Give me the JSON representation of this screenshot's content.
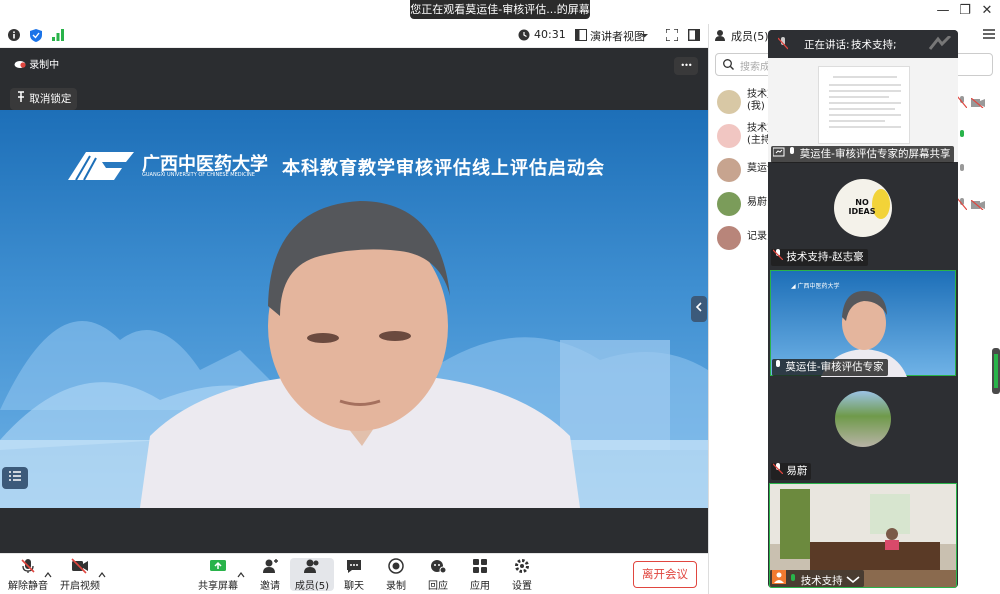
{
  "share_banner": "您正在观看莫运佳-审核评估...的屏幕",
  "window_controls": [
    "—",
    "❐",
    "✕"
  ],
  "toolbar": {
    "timer": "40:31",
    "view_mode": "演讲者视图"
  },
  "video": {
    "recording": "录制中",
    "unpin": "取消锁定",
    "more": "•••",
    "slide_title": "本科教育教学审核评估线上评估启动会",
    "logo_text": "广西中医药大学",
    "logo_sub": "GUANGXI UNIVERSITY OF CHINESE MEDICINE"
  },
  "bottom_bar": {
    "unmute": "解除静音",
    "start_video": "开启视频",
    "share": "共享屏幕",
    "invite": "邀请",
    "members": "成员(5)",
    "chat": "聊天",
    "record": "录制",
    "react": "回应",
    "apps": "应用",
    "settings": "设置",
    "leave": "离开会议"
  },
  "panel": {
    "header": "成员(5)",
    "search_placeholder": "搜索成",
    "members": [
      {
        "name": "技术支",
        "sub": "(我)"
      },
      {
        "name": "技术支",
        "sub": "(主持"
      },
      {
        "name": "莫运佳",
        "sub": ""
      },
      {
        "name": "易蔚",
        "sub": ""
      },
      {
        "name": "记录员",
        "sub": ""
      }
    ]
  },
  "float": {
    "speaking_label": "正在讲话:",
    "speaking_name": "技术支持;",
    "tiles": [
      {
        "label": "莫运佳-审核评估专家的屏幕共享"
      },
      {
        "label": "技术支持-赵志豪",
        "avatar_text": "NO IDEAS"
      },
      {
        "label": "莫运佳-审核评估专家"
      },
      {
        "label": "易蔚"
      },
      {
        "label": "技术支持"
      }
    ]
  },
  "colors": {
    "accent": "#1a73e8",
    "leave": "#e0463f",
    "green": "#29b34a"
  }
}
